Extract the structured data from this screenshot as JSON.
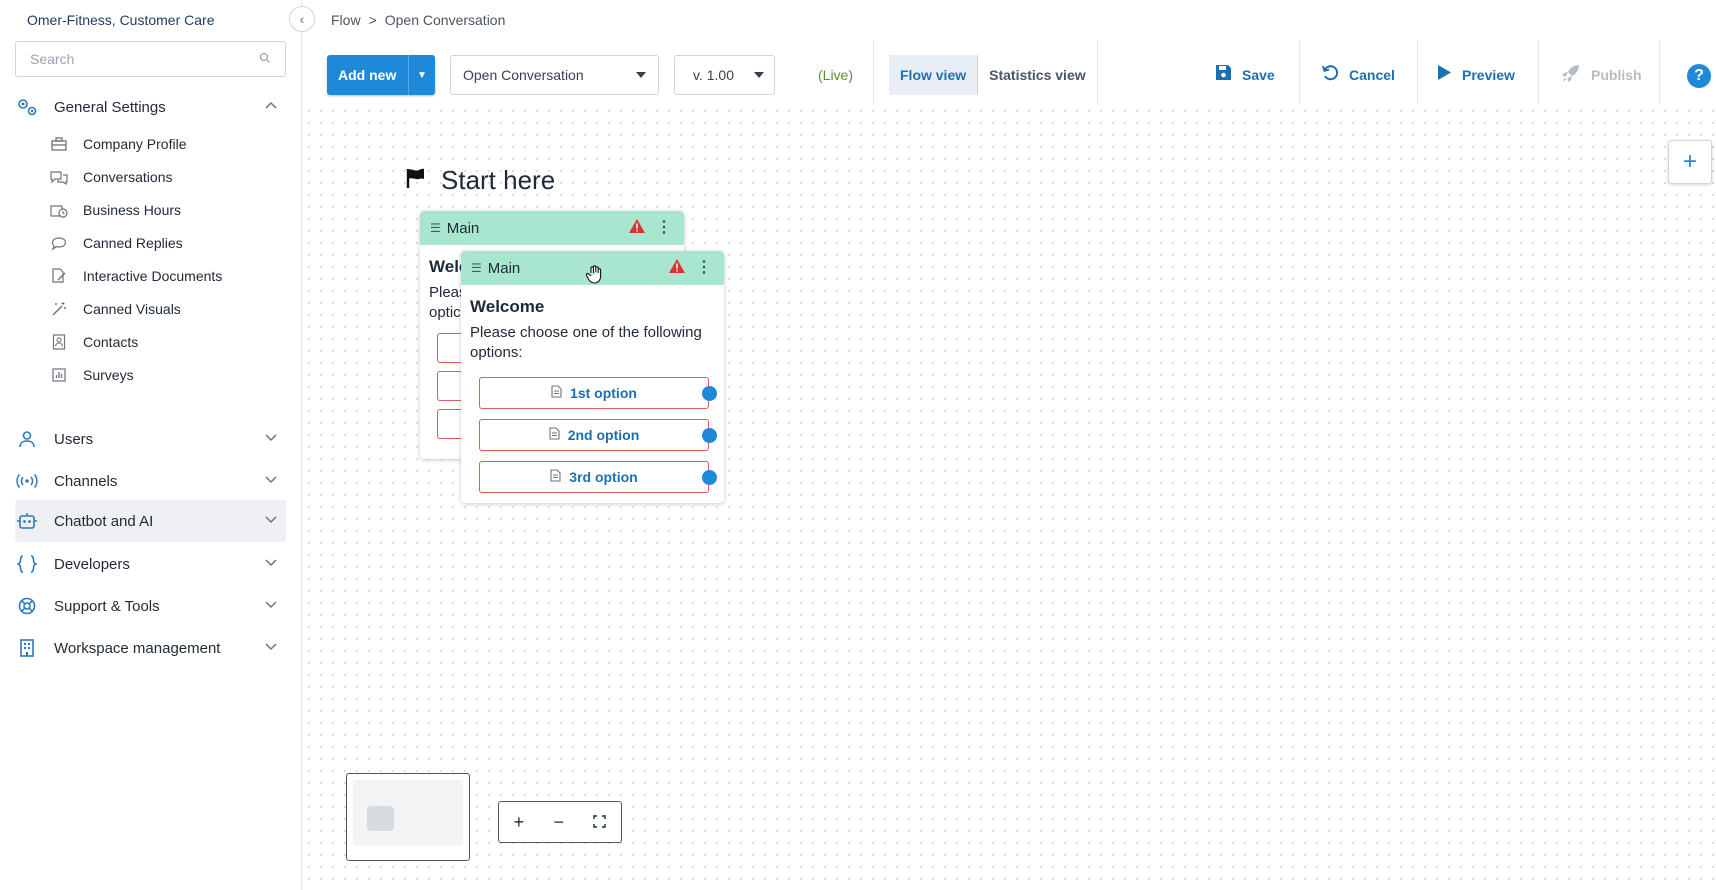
{
  "sidebar": {
    "workspace_name": "Omer-Fitness, Customer Care",
    "search_placeholder": "Search",
    "general_settings": {
      "label": "General Settings",
      "items": [
        {
          "label": "Company Profile",
          "icon": "briefcase-icon"
        },
        {
          "label": "Conversations",
          "icon": "chat-bubbles-icon"
        },
        {
          "label": "Business Hours",
          "icon": "clock-icon"
        },
        {
          "label": "Canned Replies",
          "icon": "speech-bubble-icon"
        },
        {
          "label": "Interactive Documents",
          "icon": "document-edit-icon"
        },
        {
          "label": "Canned Visuals",
          "icon": "magic-wand-icon"
        },
        {
          "label": "Contacts",
          "icon": "contacts-icon"
        },
        {
          "label": "Surveys",
          "icon": "bar-chart-icon"
        }
      ]
    },
    "groups": [
      {
        "label": "Users",
        "icon": "user-icon"
      },
      {
        "label": "Channels",
        "icon": "broadcast-icon"
      },
      {
        "label": "Chatbot and AI",
        "icon": "robot-icon"
      },
      {
        "label": "Developers",
        "icon": "braces-icon"
      },
      {
        "label": "Support & Tools",
        "icon": "lifebuoy-icon"
      },
      {
        "label": "Workspace management",
        "icon": "building-icon"
      }
    ]
  },
  "breadcrumb": {
    "root": "Flow",
    "separator": ">",
    "current": "Open Conversation"
  },
  "toolbar": {
    "add_new": "Add new",
    "flow_select": "Open Conversation",
    "version_select": "v. 1.00",
    "live": "(Live)",
    "tabs": [
      "Flow view",
      "Statistics view"
    ],
    "save": "Save",
    "cancel": "Cancel",
    "preview": "Preview",
    "publish": "Publish",
    "help": "?"
  },
  "canvas": {
    "start_label": "Start here",
    "back_card": {
      "header": "Main",
      "title": "Welc",
      "text_line1": "Pleas",
      "text_line2": "optic"
    },
    "front_card": {
      "header": "Main",
      "title": "Welcome",
      "text": "Please choose one of the following options:",
      "options": [
        "1st option",
        "2nd option",
        "3rd option"
      ]
    }
  },
  "colors": {
    "accent": "#1e88d9",
    "card_header": "#a8e6cf",
    "warning": "#e03131",
    "option_border": "#e05b5b"
  }
}
